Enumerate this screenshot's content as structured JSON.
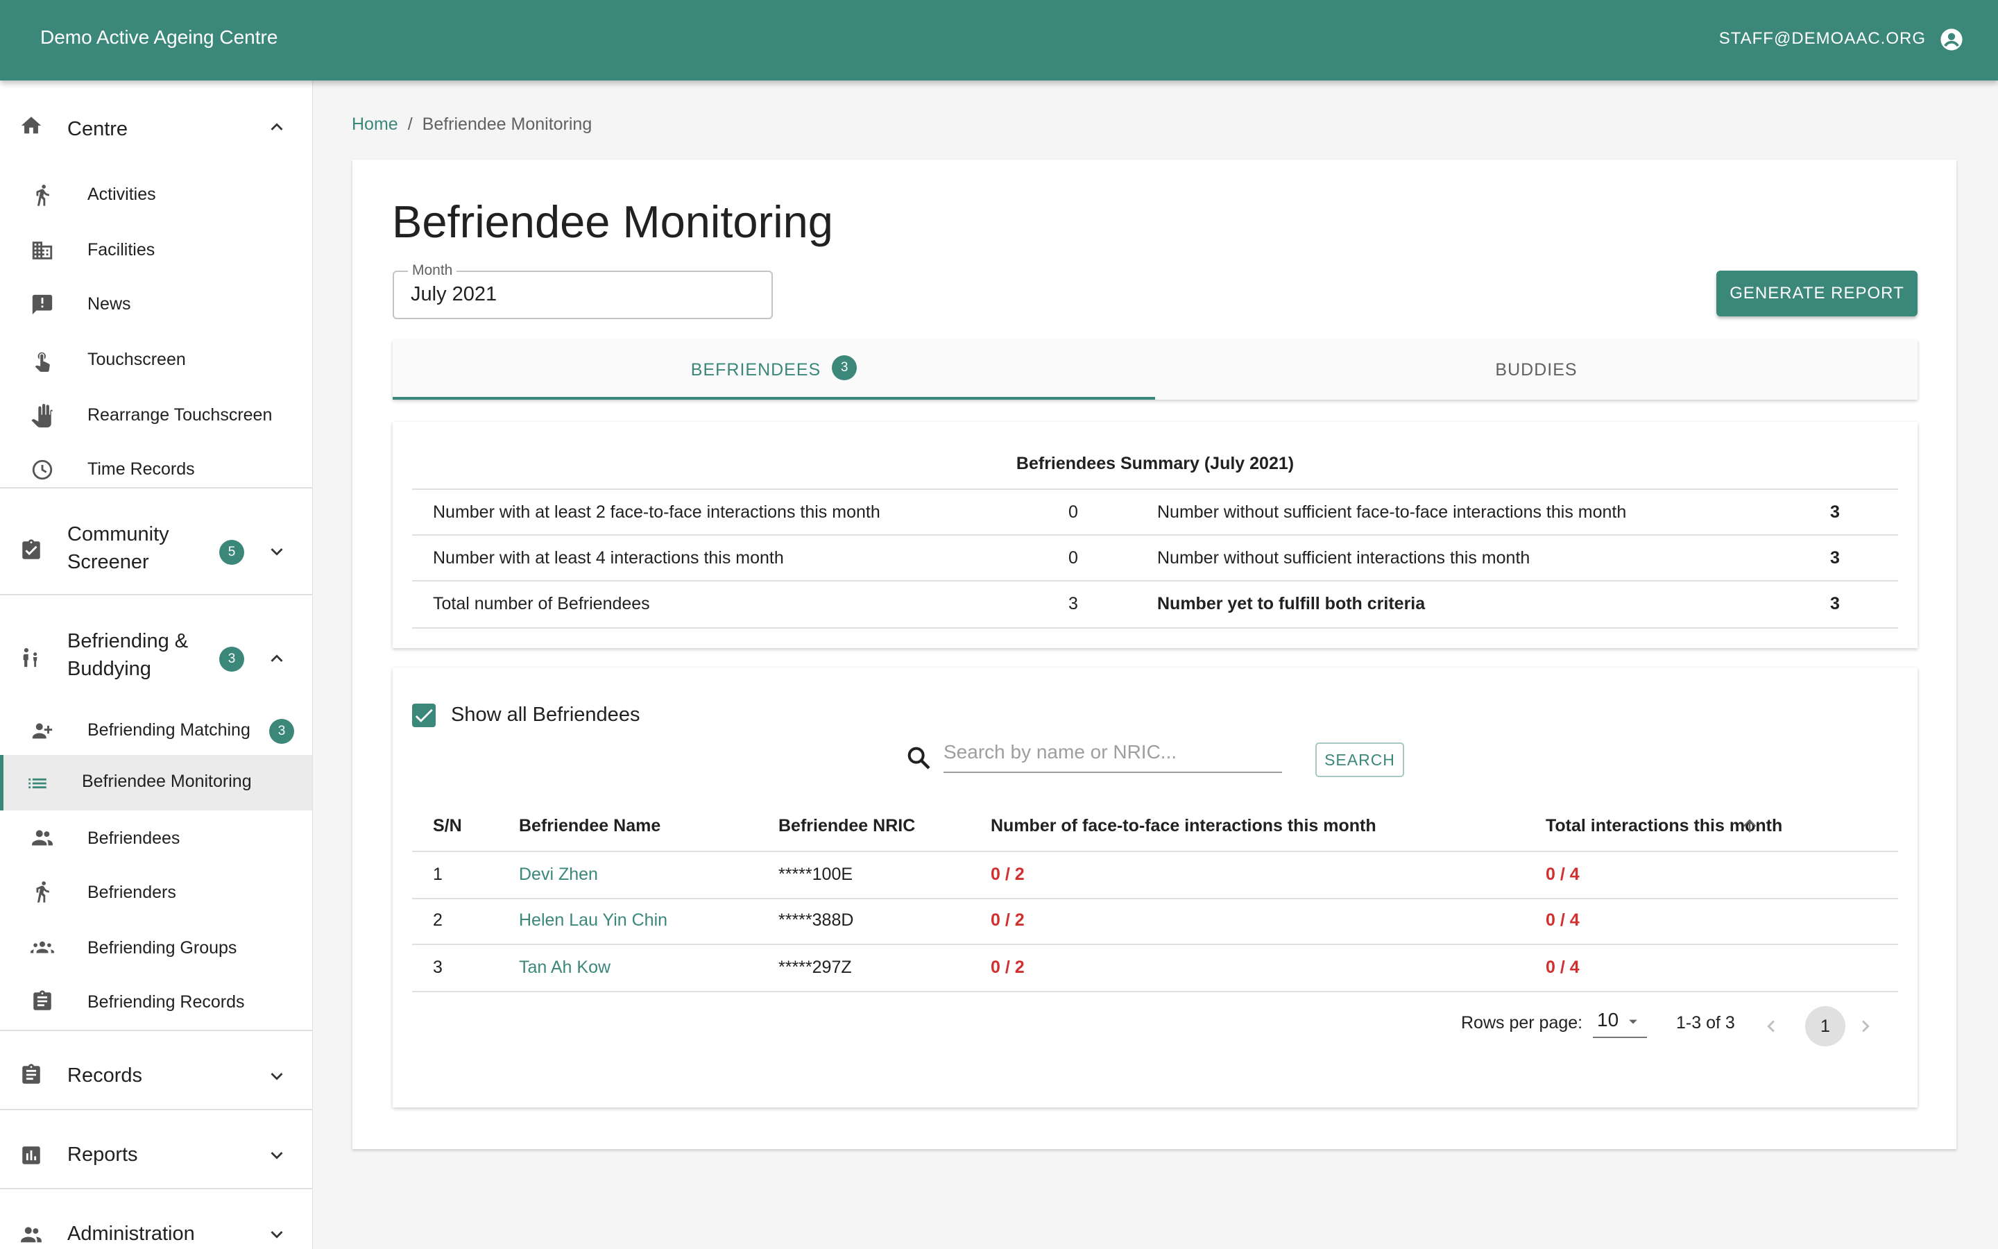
{
  "appbar": {
    "title": "Demo Active Ageing Centre",
    "user": "STAFF@DEMOAAC.ORG"
  },
  "sidebar": {
    "centre": {
      "label": "Centre",
      "items": [
        {
          "label": "Activities",
          "icon": "run-icon"
        },
        {
          "label": "Facilities",
          "icon": "building-icon"
        },
        {
          "label": "News",
          "icon": "announcement-icon"
        },
        {
          "label": "Touchscreen",
          "icon": "touch-icon"
        },
        {
          "label": "Rearrange Touchscreen",
          "icon": "hand-icon"
        },
        {
          "label": "Time Records",
          "icon": "clock-icon"
        }
      ]
    },
    "community_screener": {
      "label_line1": "Community",
      "label_line2": "Screener",
      "badge": "5"
    },
    "befriending": {
      "label_line1": "Befriending &",
      "label_line2": "Buddying",
      "badge": "3",
      "items": [
        {
          "label": "Befriending Matching",
          "badge": "3"
        },
        {
          "label": "Befriendee Monitoring"
        },
        {
          "label": "Befriendees"
        },
        {
          "label": "Befrienders"
        },
        {
          "label": "Befriending Groups"
        },
        {
          "label": "Befriending Records"
        }
      ]
    },
    "records": {
      "label": "Records"
    },
    "reports": {
      "label": "Reports"
    },
    "administration": {
      "label": "Administration"
    }
  },
  "breadcrumb": {
    "home": "Home",
    "sep": "/",
    "current": "Befriendee Monitoring"
  },
  "page": {
    "title": "Befriendee Monitoring",
    "month_label": "Month",
    "month_value": "July 2021",
    "generate_button": "GENERATE REPORT"
  },
  "tabs": {
    "befriendees": "BEFRIENDEES",
    "befriendees_badge": "3",
    "buddies": "BUDDIES"
  },
  "summary": {
    "title": "Befriendees Summary (July 2021)",
    "rows": [
      {
        "l1": "Number with at least 2 face-to-face interactions this month",
        "v1": "0",
        "l2": "Number without sufficient face-to-face interactions this month",
        "v2": "3"
      },
      {
        "l1": "Number with at least 4 interactions this month",
        "v1": "0",
        "l2": "Number without sufficient interactions this month",
        "v2": "3"
      },
      {
        "l1": "Total number of Befriendees",
        "v1": "3",
        "l2": "Number yet to fulfill both criteria",
        "v2": "3"
      }
    ]
  },
  "table": {
    "show_all_label": "Show all Befriendees",
    "search_placeholder": "Search by name or NRIC...",
    "search_button": "SEARCH",
    "headers": [
      "S/N",
      "Befriendee Name",
      "Befriendee NRIC",
      "Number of face-to-face interactions this month",
      "Total interactions this month"
    ],
    "rows": [
      {
        "sn": "1",
        "name": "Devi Zhen",
        "nric": "*****100E",
        "f2f": "0 / 2",
        "total": "0 / 4"
      },
      {
        "sn": "2",
        "name": "Helen Lau Yin Chin",
        "nric": "*****388D",
        "f2f": "0 / 2",
        "total": "0 / 4"
      },
      {
        "sn": "3",
        "name": "Tan Ah Kow",
        "nric": "*****297Z",
        "f2f": "0 / 2",
        "total": "0 / 4"
      }
    ],
    "rows_per_page_label": "Rows per page:",
    "rows_per_page": "10",
    "range": "1-3 of 3",
    "page": "1"
  },
  "colors": {
    "primary": "#3b877a",
    "alert": "#d32f2f"
  }
}
